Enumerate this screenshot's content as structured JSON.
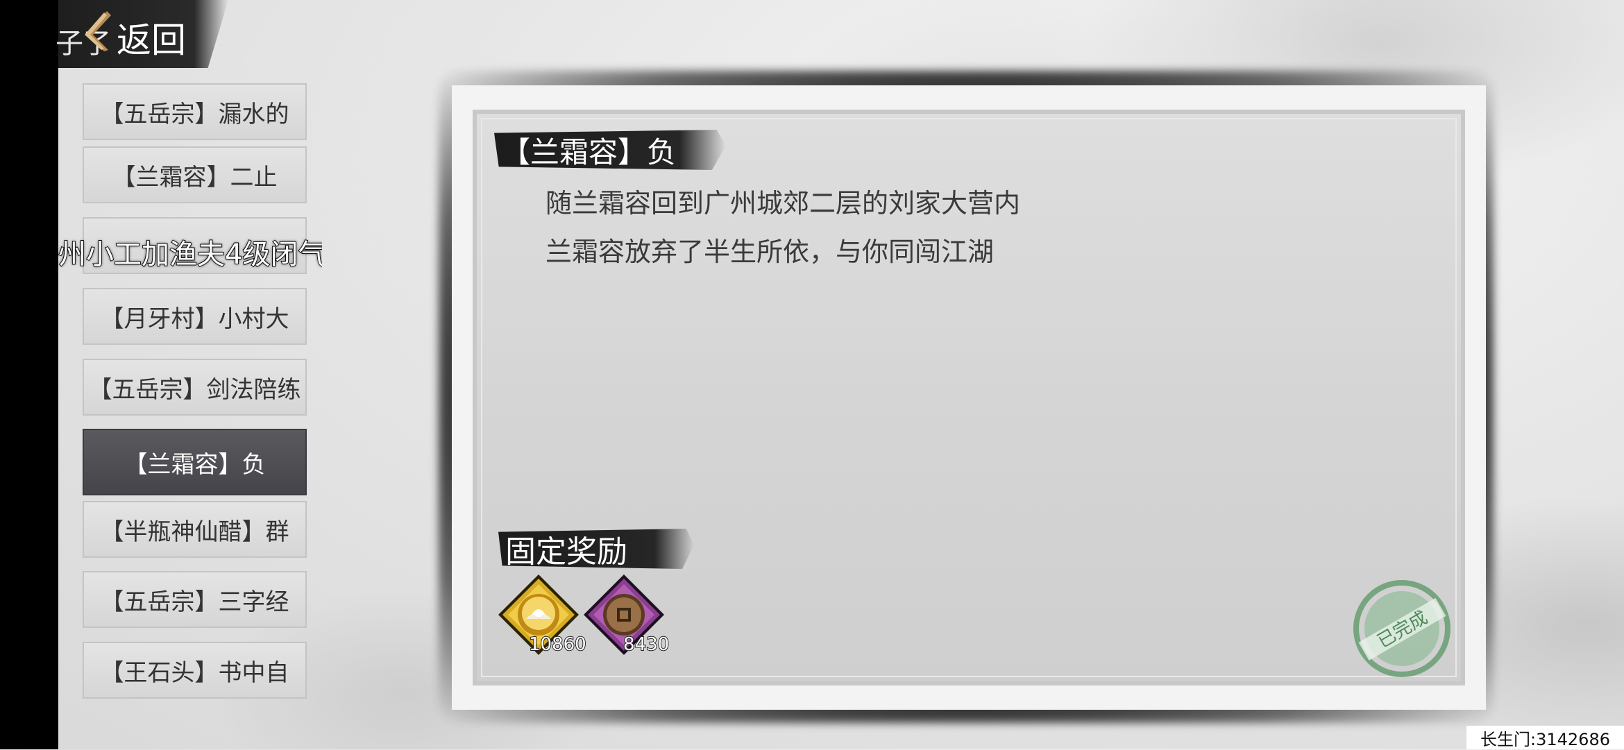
{
  "header": {
    "partial_text": "子了",
    "back_label": "返回"
  },
  "quest_list": [
    {
      "label": "【五岳宗】漏水的",
      "active": false
    },
    {
      "label": "【兰霜容】二止",
      "active": false
    },
    {
      "label": "",
      "active": false
    },
    {
      "label": "【月牙村】小村大",
      "active": false
    },
    {
      "label": "【五岳宗】剑法陪练",
      "active": false
    },
    {
      "label": "【兰霜容】负",
      "active": true
    },
    {
      "label": "【半瓶神仙醋】群",
      "active": false
    },
    {
      "label": "【五岳宗】三字经",
      "active": false
    },
    {
      "label": "【王石头】书中自",
      "active": false
    }
  ],
  "overlay_text": "州小工加渔夫4级闭气",
  "detail": {
    "title": "【兰霜容】负",
    "description": [
      "随兰霜容回到广州城郊二层的刘家大营内",
      "兰霜容放弃了半生所依，与你同闯江湖"
    ],
    "reward_heading": "固定奖励",
    "rewards": [
      {
        "icon": "gold-lotus-icon",
        "count": "10860",
        "color": "#d4a520"
      },
      {
        "icon": "copper-coin-icon",
        "count": "8430",
        "color": "#8a3f8f"
      }
    ],
    "completed_stamp": "已完成"
  },
  "server": "长生门:3142686",
  "colors": {
    "active_item": "#4c4c52",
    "stamp_green": "#5f9a6a"
  }
}
